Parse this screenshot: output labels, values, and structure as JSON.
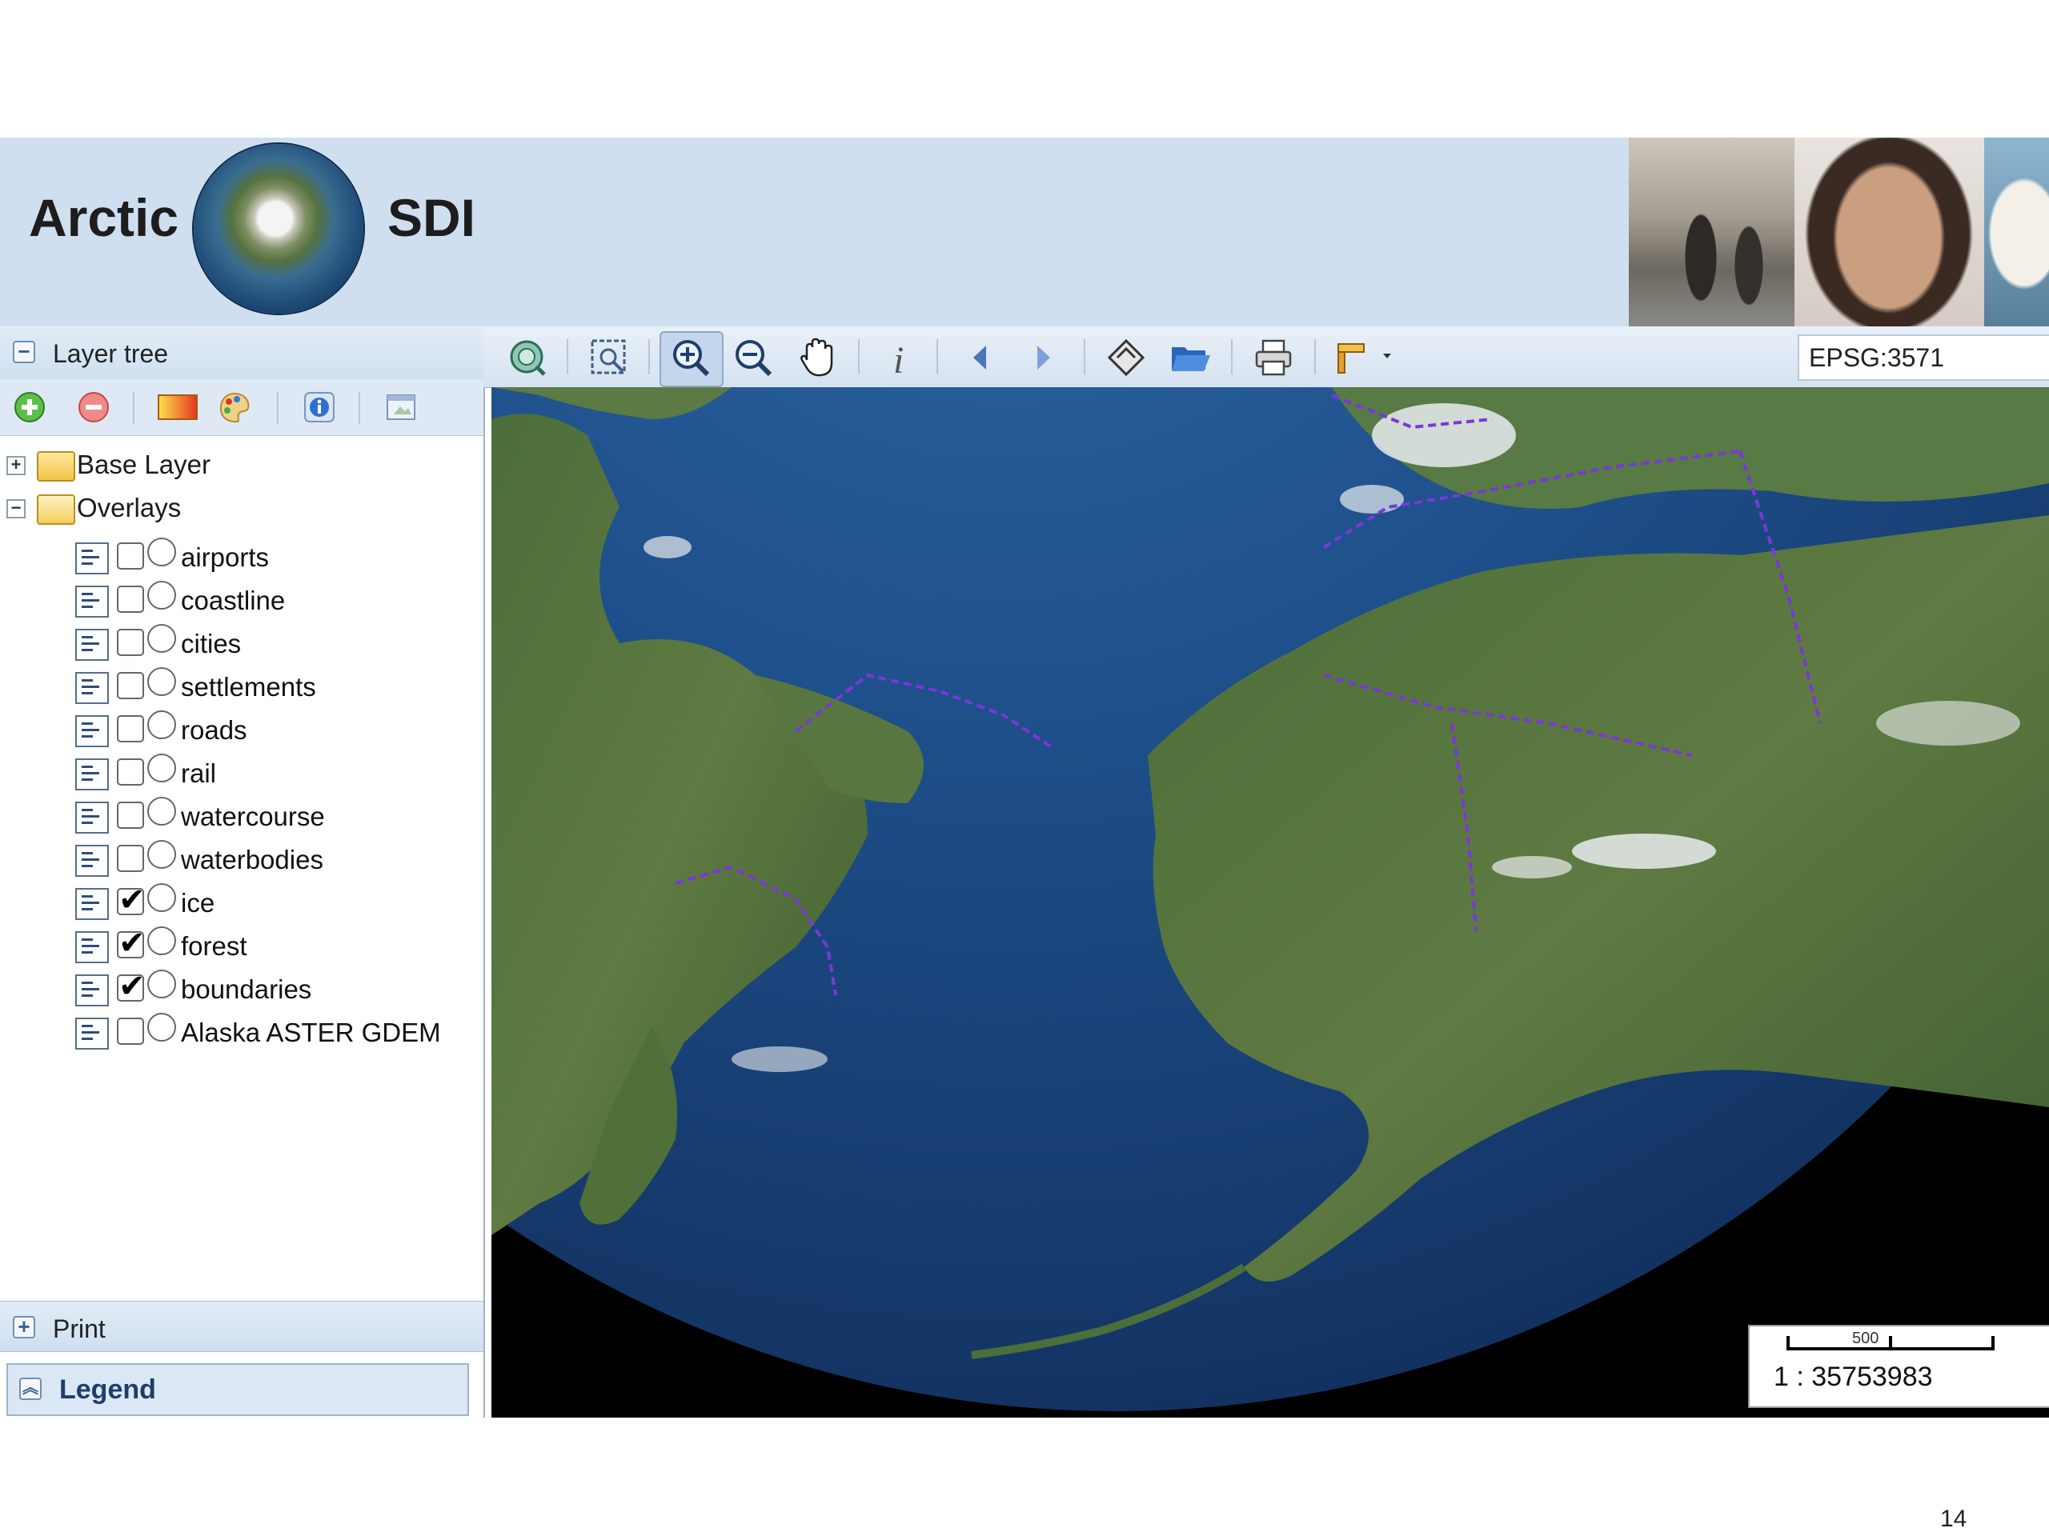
{
  "header": {
    "title_left": "Arctic",
    "title_right": "SDI",
    "logo": "arctic-globe",
    "photos": [
      "photo-birds",
      "photo-person",
      "photo-polar-bear"
    ]
  },
  "layer_tree": {
    "title": "Layer tree",
    "toolbar": [
      "add-layer-icon",
      "remove-layer-icon",
      "style-icon",
      "palette-icon",
      "info-icon",
      "preview-icon"
    ],
    "groups": [
      {
        "label": "Base Layer",
        "expanded": false
      },
      {
        "label": "Overlays",
        "expanded": true
      }
    ],
    "layers": [
      {
        "label": "airports",
        "checked": false,
        "mark": ""
      },
      {
        "label": "coastline",
        "checked": false,
        "mark": ""
      },
      {
        "label": "cities",
        "checked": false,
        "mark": ""
      },
      {
        "label": "settlements",
        "checked": false,
        "mark": ""
      },
      {
        "label": "roads",
        "checked": false,
        "mark": ""
      },
      {
        "label": "rail",
        "checked": false,
        "mark": ""
      },
      {
        "label": "watercourse",
        "checked": false,
        "mark": ""
      },
      {
        "label": "waterbodies",
        "checked": false,
        "mark": ""
      },
      {
        "label": "ice",
        "checked": true,
        "mark": "✔"
      },
      {
        "label": "forest",
        "checked": true,
        "mark": "✔"
      },
      {
        "label": "boundaries",
        "checked": true,
        "mark": "✔"
      },
      {
        "label": "Alaska ASTER GDEM",
        "checked": false,
        "mark": ""
      }
    ]
  },
  "print_panel": {
    "title": "Print"
  },
  "legend_panel": {
    "title": "Legend"
  },
  "map_toolbar": {
    "tools": [
      "zoom-extent-icon",
      "zoom-box-icon",
      "zoom-in-icon",
      "zoom-out-icon",
      "pan-hand-icon",
      "identify-icon",
      "history-back-icon",
      "history-forward-icon",
      "measure-icon",
      "open-folder-icon",
      "print-icon",
      "drawing-tool-icon"
    ],
    "active_tool": "zoom-in-icon",
    "projection": "EPSG:3571"
  },
  "map": {
    "scale_text": "1 : 35753983",
    "scale_bar_label": "500"
  },
  "page_number": "14"
}
